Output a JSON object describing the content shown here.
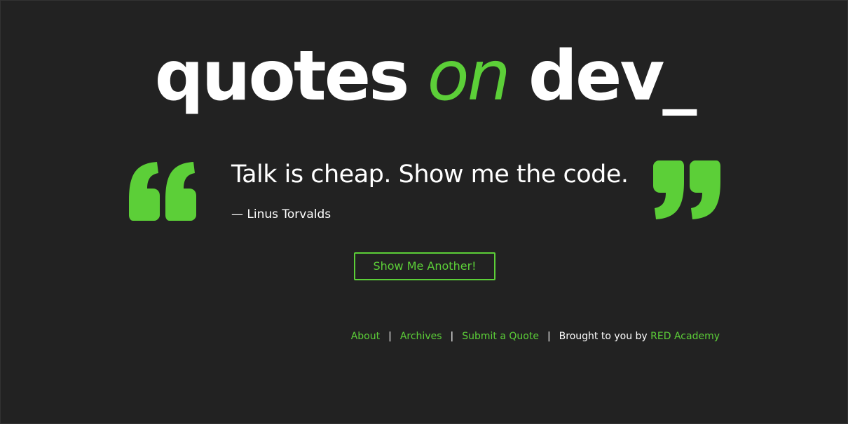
{
  "site": {
    "logo": {
      "word1": "quotes",
      "word2": "on",
      "word3": "dev_"
    }
  },
  "quote": {
    "text": "Talk is cheap. Show me the code.",
    "author": "— Linus Torvalds",
    "open_icon": "open-quote-icon",
    "close_icon": "close-quote-icon"
  },
  "actions": {
    "another_label": "Show Me Another!"
  },
  "footer": {
    "links": {
      "about": "About",
      "archives": "Archives",
      "submit": "Submit a Quote"
    },
    "separator": "|",
    "credit_prefix": "Brought to you by",
    "credit_link": "RED Academy"
  },
  "colors": {
    "background": "#222222",
    "accent": "#5ccf38",
    "text": "#ffffff"
  }
}
